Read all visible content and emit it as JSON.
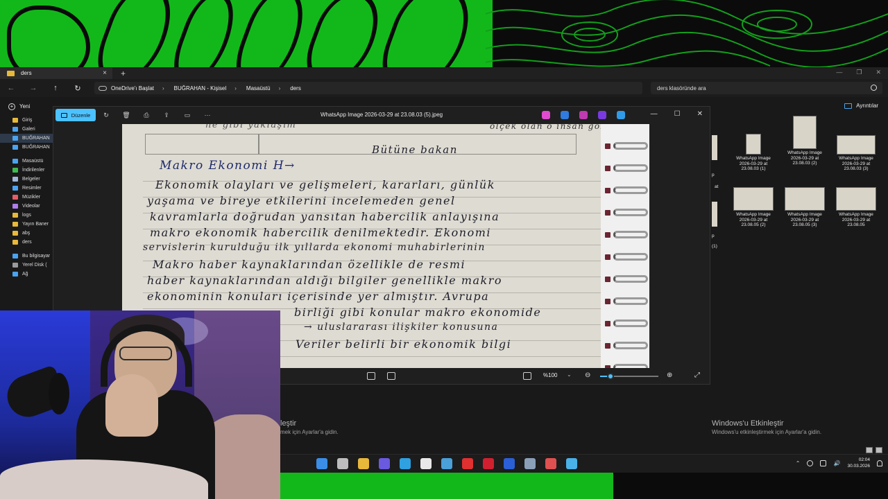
{
  "explorer": {
    "tab_title": "ders",
    "breadcrumbs": [
      "OneDrive'ı Başlat",
      "BUĞRAHAN - Kişisel",
      "Masaüstü",
      "ders"
    ],
    "search_placeholder": "ders klasöründe ara",
    "new_label": "Yeni",
    "details_label": "Ayrıntılar",
    "sidebar": [
      {
        "label": "Giriş",
        "color": "#e8b83a"
      },
      {
        "label": "Galeri",
        "color": "#4aa3f0"
      },
      {
        "label": "BUĞRAHAN",
        "color": "#4aa3f0",
        "selected": true
      },
      {
        "label": "BUĞRAHAN",
        "color": "#4aa3f0"
      },
      {
        "label": "Masaüstü",
        "color": "#4aa3f0"
      },
      {
        "label": "İndirilenler",
        "color": "#3fb950"
      },
      {
        "label": "Belgeler",
        "color": "#9fb7d8"
      },
      {
        "label": "Resimler",
        "color": "#4aa3f0"
      },
      {
        "label": "Müzikler",
        "color": "#e35d6a"
      },
      {
        "label": "Videolar",
        "color": "#b07cf0"
      },
      {
        "label": "logs",
        "color": "#e8b83a"
      },
      {
        "label": "Yayın Baner",
        "color": "#e8b83a"
      },
      {
        "label": "abş",
        "color": "#e8b83a"
      },
      {
        "label": "ders",
        "color": "#e8b83a"
      },
      {
        "label": "Bu bilgisayar",
        "color": "#4aa3f0"
      },
      {
        "label": "Yerel Disk (",
        "color": "#9a9a9a"
      },
      {
        "label": "Ağ",
        "color": "#4aa3f0"
      }
    ],
    "files": [
      {
        "name": "WhatsApp Image 2026-03-29 at 23.08.03 (1)"
      },
      {
        "name": "WhatsApp Image 2026-03-29 at 23.08.03 (2)"
      },
      {
        "name": "WhatsApp Image 2026-03-29 at 23.08.03 (3)"
      },
      {
        "name": "WhatsApp Image 2026-03-29 at 23.08.05 (2)"
      },
      {
        "name": "WhatsApp Image 2026-03-29 at 23.08.05 (3)"
      },
      {
        "name": "WhatsApp Image 2026-03-29 at 23.08.05"
      }
    ],
    "partial_labels": [
      "p",
      "at",
      "p",
      "(1)"
    ]
  },
  "viewer": {
    "edit_label": "Düzenle",
    "filename": "WhatsApp Image 2026-03-29 at 23.08.03 (5).jpeg",
    "zoom": "%100",
    "zoom_fraction": 0.18,
    "app_colors": [
      "#e04bd0",
      "#2f7be0",
      "#c03ab0",
      "#7a3ae0",
      "#2f9be8"
    ]
  },
  "note": {
    "top_scribble": "ölçek olan o insan gözlem",
    "bubble_text": "Bütüne bakan",
    "heading": "Makro Ekonomi H→",
    "lines": [
      "Ekonomik olayları ve gelişmeleri, kararları, günlük",
      "yaşama ve bireye etkilerini incelemeden genel",
      "kavramlarla doğrudan yansıtan habercilik anlayışına",
      "makro ekonomik habercilik denilmektedir. Ekonomi",
      "servislerin kurulduğu ilk yıllarda ekonomi muhabirlerinin",
      "Makro haber kaynaklarından özellikle de resmi",
      "haber kaynaklarından aldığı bilgiler genellikle makro",
      "ekonominin konuları içerisinde yer almıştır. Avrupa",
      "birliği gibi konular makro ekonomide",
      "→ uluslararası ilişkiler konusuna",
      "Veriler belirli bir ekonomik bilgi"
    ]
  },
  "activation": {
    "title": "Windows'u Etkinleştir",
    "subtitle": "Windows'u etkinleştirmek için Ayarlar'a gidin.",
    "title_partial": "leştir",
    "subtitle_partial": "mek için Ayarlar'a gidin."
  },
  "taskbar": {
    "time": "02:04",
    "date": "30.03.2026",
    "app_colors": [
      "#3a8ee8",
      "#bdbdbd",
      "#e8b83a",
      "#6a5ae0",
      "#2fa0e0",
      "#e8e8e8",
      "#4aa0d8",
      "#e03030",
      "#d02030",
      "#2b5fd8",
      "#8aa0b8",
      "#e05050",
      "#4ab0e8"
    ]
  }
}
